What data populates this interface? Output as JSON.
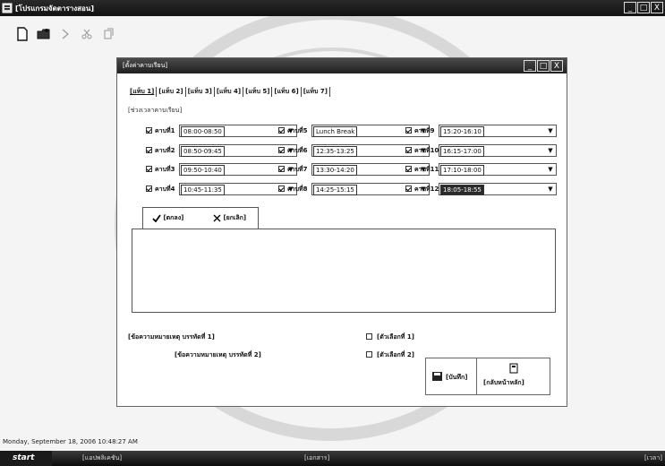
{
  "app": {
    "title": "[โปรแกรมจัดตารางสอน]",
    "controls": [
      "_",
      "□",
      "X"
    ]
  },
  "toolbar": {
    "icons": [
      "new-document-icon",
      "open-folder-icon",
      "arrow-icon",
      "cut-icon",
      "copy-icon"
    ]
  },
  "dialog": {
    "title": "[ตั้งค่าคาบเรียน]",
    "controls": [
      "_",
      "□",
      "X"
    ],
    "tabs": [
      "[แท็บ 1]",
      "[แท็บ 2]",
      "[แท็บ 3]",
      "[แท็บ 4]",
      "[แท็บ 5]",
      "[แท็บ 6]",
      "[แท็บ 7]"
    ],
    "group_label": "[ช่วงเวลาคาบเรียน]",
    "periods": [
      {
        "label": "คาบที่1",
        "value": "08:00-08:50",
        "selected": false
      },
      {
        "label": "คาบที่2",
        "value": "08:50-09:45",
        "selected": false
      },
      {
        "label": "คาบที่3",
        "value": "09:50-10:40",
        "selected": false
      },
      {
        "label": "คาบที่4",
        "value": "10:45-11:35",
        "selected": false
      },
      {
        "label": "คาบที่5",
        "value": "Lunch Break",
        "selected": false
      },
      {
        "label": "คาบที่6",
        "value": "12:35-13:25",
        "selected": false
      },
      {
        "label": "คาบที่7",
        "value": "13:30-14:20",
        "selected": false
      },
      {
        "label": "คาบที่8",
        "value": "14:25-15:15",
        "selected": false
      },
      {
        "label": "คาบที่9",
        "value": "15:20-16:10",
        "selected": false
      },
      {
        "label": "คาบที่10",
        "value": "16:15-17:00",
        "selected": false
      },
      {
        "label": "คาบที่11",
        "value": "17:10-18:00",
        "selected": false
      },
      {
        "label": "คาบที่12",
        "value": "18:05-18:55",
        "selected": true
      }
    ],
    "actions": {
      "confirm_label": "[ตกลง]",
      "cancel_label": "[ยกเลิก]"
    },
    "notes": {
      "note1": "[ข้อความหมายเหตุ บรรทัดที่ 1]",
      "note2": "[ข้อความหมายเหตุ บรรทัดที่ 2]",
      "option1": "[ตัวเลือกที่ 1]",
      "option2": "[ตัวเลือกที่ 2]"
    },
    "buttons": {
      "save_label": "[บันทึก]",
      "back_label": "[กลับหน้าหลัก]"
    }
  },
  "status": {
    "datetime": "Monday, September 18, 2006 10:48:27 AM"
  },
  "taskbar": {
    "start_label": "start",
    "tasks": [
      "[แอปพลิเคชัน]",
      "[เอกสาร]"
    ],
    "tray_time": "[เวลา]"
  }
}
